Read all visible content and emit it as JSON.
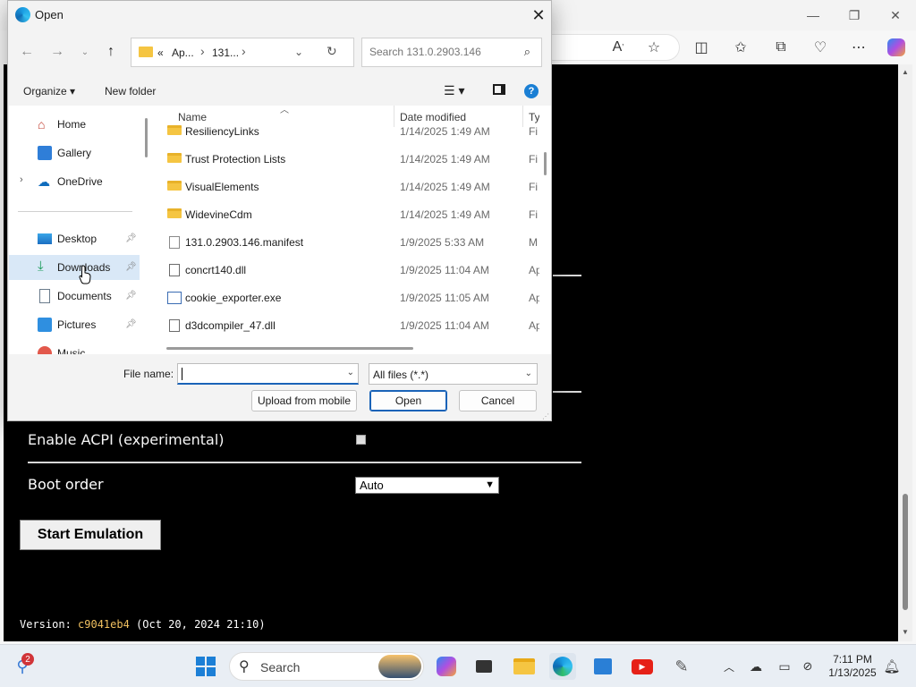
{
  "dialog": {
    "title": "Open",
    "breadcrumb": {
      "overflow": "«",
      "segments": [
        "Ap...",
        "131..."
      ]
    },
    "search_placeholder": "Search 131.0.2903.146",
    "commands": {
      "organize": "Organize ▾",
      "new_folder": "New folder"
    },
    "nav_items": [
      {
        "label": "Home",
        "icon": "home-icon",
        "pinned": false
      },
      {
        "label": "Gallery",
        "icon": "gallery-icon",
        "pinned": false
      },
      {
        "label": "OneDrive",
        "icon": "onedrive-icon",
        "pinned": false
      },
      {
        "label": "Desktop",
        "icon": "desktop-icon",
        "pinned": true
      },
      {
        "label": "Downloads",
        "icon": "download-icon",
        "pinned": true
      },
      {
        "label": "Documents",
        "icon": "documents-icon",
        "pinned": true
      },
      {
        "label": "Pictures",
        "icon": "pictures-icon",
        "pinned": true
      },
      {
        "label": "Music",
        "icon": "music-icon",
        "pinned": true
      }
    ],
    "columns": {
      "name": "Name",
      "date": "Date modified",
      "type": "Ty"
    },
    "files": [
      {
        "name": "ResiliencyLinks",
        "date": "1/14/2025 1:49 AM",
        "type": "Fi",
        "kind": "folder"
      },
      {
        "name": "Trust Protection Lists",
        "date": "1/14/2025 1:49 AM",
        "type": "Fi",
        "kind": "folder"
      },
      {
        "name": "VisualElements",
        "date": "1/14/2025 1:49 AM",
        "type": "Fi",
        "kind": "folder"
      },
      {
        "name": "WidevineCdm",
        "date": "1/14/2025 1:49 AM",
        "type": "Fi",
        "kind": "folder"
      },
      {
        "name": "131.0.2903.146.manifest",
        "date": "1/9/2025 5:33 AM",
        "type": "M",
        "kind": "file"
      },
      {
        "name": "concrt140.dll",
        "date": "1/9/2025 11:04 AM",
        "type": "Ap",
        "kind": "dll"
      },
      {
        "name": "cookie_exporter.exe",
        "date": "1/9/2025 11:05 AM",
        "type": "Ap",
        "kind": "exe"
      },
      {
        "name": "d3dcompiler_47.dll",
        "date": "1/9/2025 11:04 AM",
        "type": "Ap",
        "kind": "dll"
      }
    ],
    "file_name_label": "File name:",
    "file_name_value": "",
    "file_type": "All files (*.*)",
    "buttons": {
      "upload": "Upload from mobile",
      "open": "Open",
      "cancel": "Cancel"
    }
  },
  "page": {
    "acpi_label": "Enable ACPI (experimental)",
    "boot_label": "Boot order",
    "boot_value": "Auto",
    "start_button": "Start Emulation",
    "version_prefix": "Version: ",
    "version_hash": "c9041eb4",
    "version_suffix": " (Oct 20, 2024 21:10)"
  },
  "taskbar": {
    "search_label": "Search",
    "notification_count": "2",
    "time": "7:11 PM",
    "date": "1/13/2025"
  }
}
